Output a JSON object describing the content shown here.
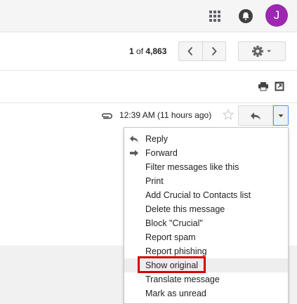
{
  "topbar": {
    "apps_icon": "apps-grid-icon",
    "notifications_icon": "notifications-icon",
    "avatar_initial": "J",
    "avatar_color": "#9c27b0"
  },
  "toolbar": {
    "pager_current": "1",
    "pager_of": " of ",
    "pager_total": "4,863",
    "prev_icon": "chevron-left-icon",
    "next_icon": "chevron-right-icon",
    "settings_icon": "gear-icon"
  },
  "subject_actions": {
    "print_icon": "print-icon",
    "new_window_icon": "open-in-new-window-icon"
  },
  "message": {
    "attachment_icon": "paperclip-icon",
    "date": "12:39 AM (11 hours ago)",
    "star_icon": "star-outline-icon",
    "reply_icon": "reply-icon",
    "more_icon": "caret-down-icon"
  },
  "menu": {
    "items": [
      {
        "label": "Reply",
        "icon": "reply-icon"
      },
      {
        "label": "Forward",
        "icon": "forward-icon"
      },
      {
        "label": "Filter messages like this"
      },
      {
        "label": "Print"
      },
      {
        "label": "Add Crucial to Contacts list"
      },
      {
        "label": "Delete this message"
      },
      {
        "label": "Block \"Crucial\""
      },
      {
        "label": "Report spam"
      },
      {
        "label": "Report phishing"
      },
      {
        "label": "Show original"
      },
      {
        "label": "Translate message"
      },
      {
        "label": "Mark as unread"
      }
    ],
    "highlighted_item": "Show original",
    "highlight_color": "#d50000"
  }
}
